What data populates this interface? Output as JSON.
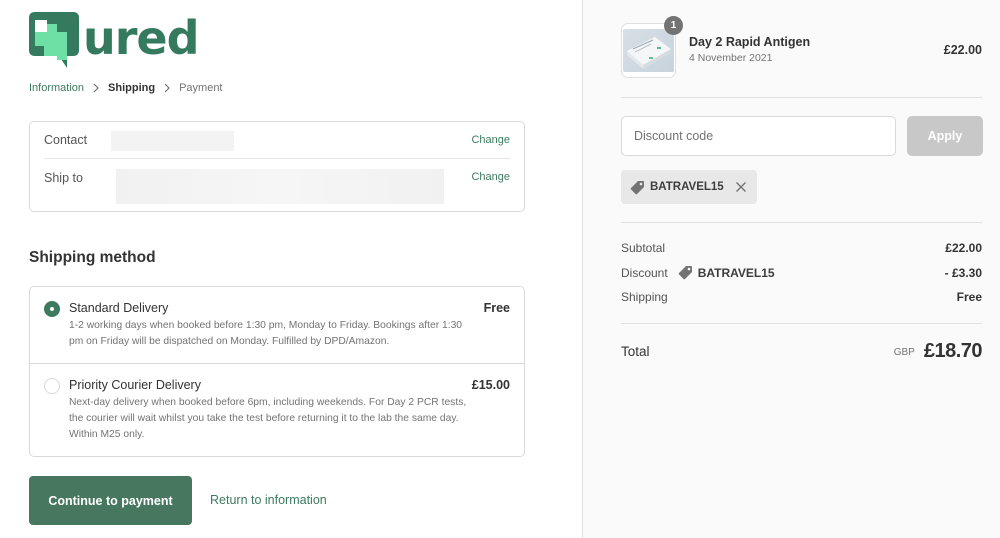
{
  "brand": {
    "name": "Qured",
    "logo_text": "ured",
    "primary_color": "#3d7a5f",
    "logo_dark": "#357a5e",
    "logo_light": "#6ee0a6"
  },
  "breadcrumb": {
    "items": [
      {
        "label": "Information",
        "state": "link"
      },
      {
        "label": "Shipping",
        "state": "current"
      },
      {
        "label": "Payment",
        "state": "inactive"
      }
    ]
  },
  "review": {
    "contact_label": "Contact",
    "ship_to_label": "Ship to",
    "change_label": "Change"
  },
  "shipping": {
    "title": "Shipping method",
    "options": [
      {
        "title": "Standard Delivery",
        "description": "1-2 working days when booked before 1:30 pm, Monday to Friday. Bookings after 1:30 pm on Friday will be dispatched on Monday. Fulfilled by DPD/Amazon.",
        "price": "Free",
        "selected": true
      },
      {
        "title": "Priority Courier Delivery",
        "description": "Next-day delivery when booked before 6pm, including weekends. For Day 2 PCR tests, the courier will wait whilst you take the test before returning it to the lab the same day. Within M25 only.",
        "price": "£15.00",
        "selected": false
      }
    ]
  },
  "actions": {
    "continue_label": "Continue to payment",
    "return_label": "Return to information"
  },
  "order": {
    "product": {
      "name": "Day 2 Rapid Antigen",
      "subtitle": "4 November 2021",
      "price": "£22.00",
      "quantity": "1"
    },
    "discount": {
      "placeholder": "Discount code",
      "value": "",
      "apply_label": "Apply",
      "applied_code": "BATRAVEL15"
    },
    "summary": {
      "subtotal_label": "Subtotal",
      "subtotal_value": "£22.00",
      "discount_label": "Discount",
      "discount_code": "BATRAVEL15",
      "discount_value": "- £3.30",
      "shipping_label": "Shipping",
      "shipping_value": "Free"
    },
    "total": {
      "label": "Total",
      "currency": "GBP",
      "value": "£18.70"
    }
  }
}
